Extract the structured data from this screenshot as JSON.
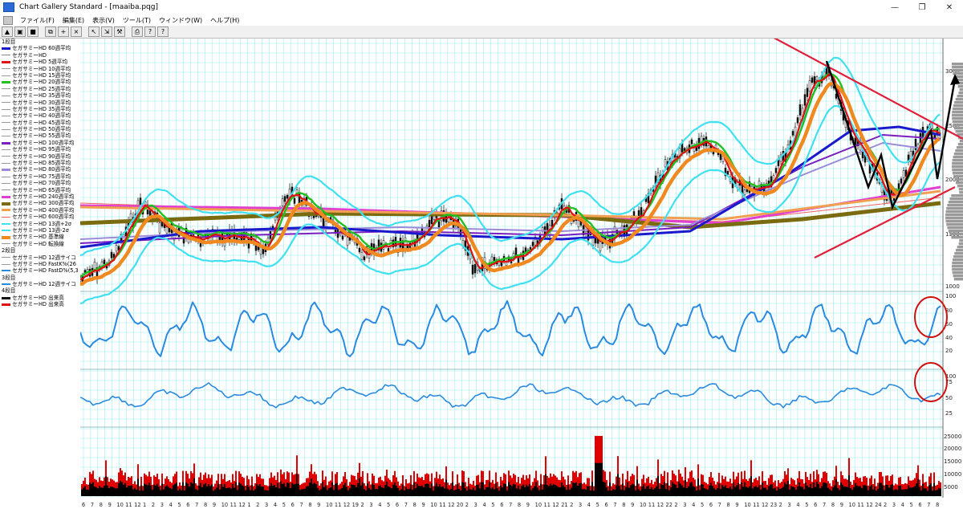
{
  "window": {
    "title": "Chart Gallery Standard - [maaiba.pqg]",
    "controls": [
      "—",
      "❐",
      "✕"
    ]
  },
  "menu": {
    "items": [
      "ファイル(F)",
      "編集(E)",
      "表示(V)",
      "ツール(T)",
      "ウィンドウ(W)",
      "ヘルプ(H)"
    ]
  },
  "toolbar": {
    "buttons": [
      {
        "icon": "chart-icon",
        "glyph": "▲"
      },
      {
        "icon": "open-icon",
        "glyph": "▣"
      },
      {
        "icon": "save-icon",
        "glyph": "■"
      },
      {
        "icon": "copy-icon",
        "glyph": "⧉"
      },
      {
        "icon": "add-icon",
        "glyph": "+"
      },
      {
        "icon": "delete-icon",
        "glyph": "×"
      },
      {
        "icon": "cursor-icon",
        "glyph": "↖"
      },
      {
        "icon": "zoom-icon",
        "glyph": "⇲"
      },
      {
        "icon": "tool-icon",
        "glyph": "⚒"
      },
      {
        "icon": "print-icon",
        "glyph": "⎙"
      },
      {
        "icon": "help-icon",
        "glyph": "?"
      },
      {
        "icon": "context-help-icon",
        "glyph": "?"
      }
    ]
  },
  "legend": {
    "sections": [
      {
        "header": "1段目",
        "items": [
          {
            "label": "セガサミーHD 60週平均",
            "color": "#1a1acc",
            "height": 3
          },
          {
            "label": "セガサミーHD",
            "color": "#888888",
            "height": 1
          },
          {
            "label": "セガサミーHD 5週平均",
            "color": "#e01010",
            "height": 3
          },
          {
            "label": "セガサミーHD 10週平均",
            "color": "#999999",
            "height": 1
          },
          {
            "label": "セガサミーHD 15週平均",
            "color": "#999999",
            "height": 1
          },
          {
            "label": "セガサミーHD 20週平均",
            "color": "#20c020",
            "height": 3
          },
          {
            "label": "セガサミーHD 25週平均",
            "color": "#999999",
            "height": 1
          },
          {
            "label": "セガサミーHD 35週平均",
            "color": "#999999",
            "height": 1
          },
          {
            "label": "セガサミーHD 30週平均",
            "color": "#999999",
            "height": 1
          },
          {
            "label": "セガサミーHD 35週平均",
            "color": "#999999",
            "height": 1
          },
          {
            "label": "セガサミーHD 40週平均",
            "color": "#999999",
            "height": 1
          },
          {
            "label": "セガサミーHD 45週平均",
            "color": "#999999",
            "height": 1
          },
          {
            "label": "セガサミーHD 50週平均",
            "color": "#999999",
            "height": 1
          },
          {
            "label": "セガサミーHD 55週平均",
            "color": "#999999",
            "height": 1
          },
          {
            "label": "セガサミーHD 100週平均",
            "color": "#7a1ec0",
            "height": 3
          },
          {
            "label": "セガサミーHD 95週平均",
            "color": "#999999",
            "height": 1
          },
          {
            "label": "セガサミーHD 90週平均",
            "color": "#999999",
            "height": 1
          },
          {
            "label": "セガサミーHD 85週平均",
            "color": "#999999",
            "height": 1
          },
          {
            "label": "セガサミーHD 80週平均",
            "color": "#9b8bd8",
            "height": 3
          },
          {
            "label": "セガサミーHD 75週平均",
            "color": "#999999",
            "height": 1
          },
          {
            "label": "セガサミーHD 70週平均",
            "color": "#999999",
            "height": 1
          },
          {
            "label": "セガサミーHD 65週平均",
            "color": "#999999",
            "height": 1
          },
          {
            "label": "セガサミーHD 240週平均",
            "color": "#e040d0",
            "height": 3
          },
          {
            "label": "セガサミーHD 300週平均",
            "color": "#7a6b10",
            "height": 4
          },
          {
            "label": "セガサミーHD 400週平均",
            "color": "#f0a050",
            "height": 3
          },
          {
            "label": "セガサミーHD 600週平均",
            "color": "#f06060",
            "height": 1
          },
          {
            "label": "セガサミーHD 13週+2σ",
            "color": "#40e0f0",
            "height": 2
          },
          {
            "label": "セガサミーHD 13週-2σ",
            "color": "#40e0f0",
            "height": 2
          },
          {
            "label": "セガサミーHD 基準線",
            "color": "#f08a20",
            "height": 4
          },
          {
            "label": "セガサミーHD 転換線",
            "color": "#999999",
            "height": 1
          }
        ]
      },
      {
        "header": "2段目",
        "items": [
          {
            "label": "セガサミーHD 12週サイコ",
            "color": "#999999",
            "height": 1
          },
          {
            "label": "セガサミーHD FastK%(26",
            "color": "#999999",
            "height": 1
          },
          {
            "label": "セガサミーHD FastD%(5,3",
            "color": "#2a8ae0",
            "height": 2
          }
        ]
      },
      {
        "header": "3段目",
        "items": [
          {
            "label": "セガサミーHD 12週サイコ",
            "color": "#2a8ae0",
            "height": 2
          }
        ]
      },
      {
        "header": "4段目",
        "items": [
          {
            "label": "セガサミーHD 出来高",
            "color": "#111111",
            "height": 3
          },
          {
            "label": "セガサミーHD 出来高",
            "color": "#e01010",
            "height": 3
          }
        ]
      }
    ]
  },
  "axes": {
    "price_ticks": [
      "3000",
      "2500",
      "2000",
      "1500",
      "1000"
    ],
    "psycho_ticks": [
      "100",
      "80",
      "60",
      "40",
      "20"
    ],
    "stoch_ticks": [
      "100",
      "75",
      "50",
      "25"
    ],
    "volume_ticks": [
      "25000",
      "20000",
      "15000",
      "10000",
      "5000"
    ],
    "x_labels": [
      "6",
      "7",
      "8",
      "9",
      "10",
      "11",
      "12",
      "1",
      "2",
      "3",
      "4",
      "5",
      "6",
      "7",
      "8",
      "9",
      "10",
      "11",
      "12",
      "1",
      "2",
      "3",
      "4",
      "5",
      "6",
      "7",
      "8",
      "9",
      "10",
      "11",
      "12",
      "19",
      "2",
      "3",
      "4",
      "5",
      "6",
      "7",
      "8",
      "9",
      "10",
      "11",
      "12",
      "20",
      "2",
      "3",
      "4",
      "5",
      "6",
      "7",
      "8",
      "9",
      "10",
      "11",
      "12",
      "21",
      "2",
      "3",
      "4",
      "5",
      "6",
      "7",
      "8",
      "9",
      "10",
      "11",
      "12",
      "22",
      "2",
      "3",
      "4",
      "5",
      "6",
      "7",
      "8",
      "9",
      "10",
      "11",
      "12",
      "23",
      "2",
      "3",
      "4",
      "5",
      "6",
      "7",
      "8",
      "9",
      "10",
      "11",
      "12",
      "24",
      "2",
      "3",
      "4",
      "5",
      "6",
      "7",
      "8"
    ]
  },
  "colors": {
    "grid_cyan": "#9eecf4",
    "grid_grey": "#b8c8d8",
    "red_trend": "#e0203a",
    "black_path": "#000000",
    "psycho_line": "#2a8ae0",
    "volume_red": "#e00000",
    "volume_black": "#000000"
  }
}
